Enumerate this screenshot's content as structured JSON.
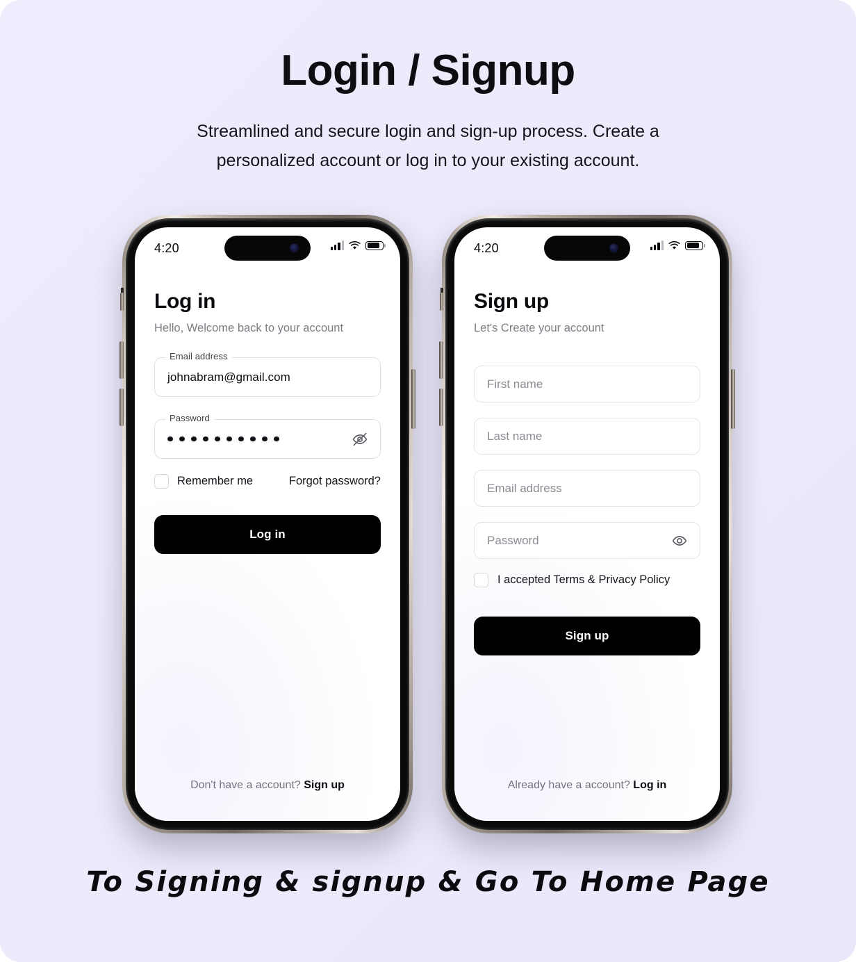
{
  "header": {
    "title": "Login / Signup",
    "subtitle": "Streamlined and secure login and sign-up process. Create a personalized account or log in to your existing account."
  },
  "caption": "To Signing & signup & Go To Home Page",
  "theme": {
    "background": "#ECEAFB",
    "cta_background": "#000000",
    "cta_text": "#FFFFFF",
    "field_border": "#DEDEE3",
    "muted_text": "#7D7D86",
    "primary_text": "#0A0A0F"
  },
  "status_bar": {
    "time": "4:20",
    "signal_icon": "cellular-bars-icon",
    "wifi_icon": "wifi-icon",
    "battery_icon": "battery-icon",
    "battery_level": "72%"
  },
  "login": {
    "title": "Log in",
    "subtitle": "Hello, Welcome back to your account",
    "email": {
      "label": "Email address",
      "value": "johnabram@gmail.com"
    },
    "password": {
      "label": "Password",
      "masked_value": "••••••••••",
      "dot_count": 10,
      "toggle_icon": "eye-off-icon"
    },
    "remember_me": {
      "label": "Remember me",
      "checked": false
    },
    "forgot_password": "Forgot password?",
    "cta": "Log in",
    "footer_prefix": "Don't have a account?",
    "footer_link": "Sign up"
  },
  "signup": {
    "title": "Sign up",
    "subtitle": "Let's Create your account",
    "fields": [
      {
        "name": "first-name",
        "placeholder": "First name",
        "value": ""
      },
      {
        "name": "last-name",
        "placeholder": "Last name",
        "value": ""
      },
      {
        "name": "email",
        "placeholder": "Email address",
        "value": ""
      },
      {
        "name": "password",
        "placeholder": "Password",
        "value": "",
        "toggle_icon": "eye-icon"
      }
    ],
    "terms": {
      "label": "I accepted Terms & Privacy Policy",
      "checked": false
    },
    "cta": "Sign up",
    "footer_prefix": "Already have a account?",
    "footer_link": "Log in"
  }
}
